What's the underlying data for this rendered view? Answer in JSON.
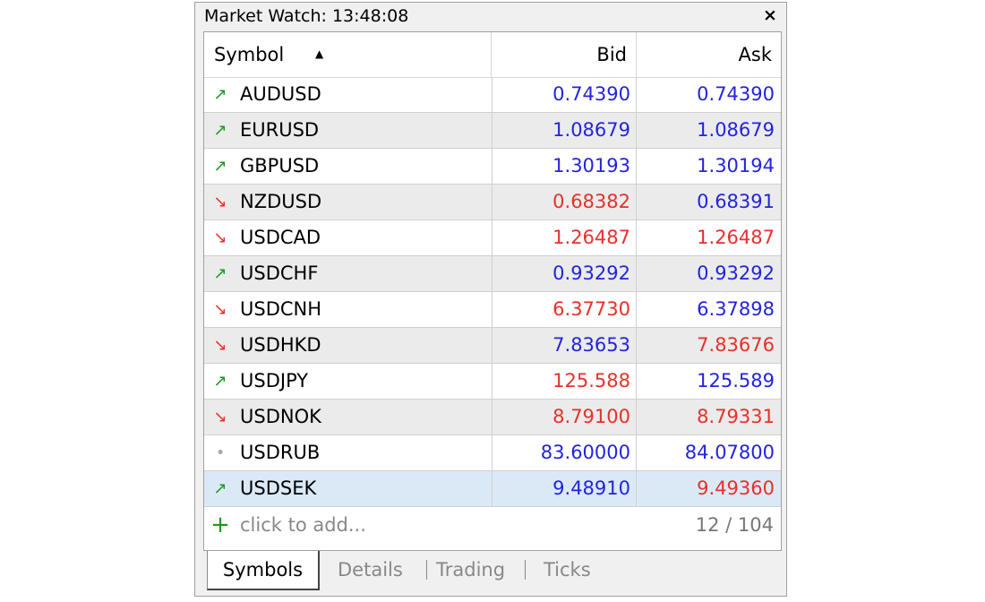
{
  "window": {
    "title": "Market Watch: 13:48:08",
    "close_glyph": "×"
  },
  "columns": {
    "symbol": "Symbol",
    "bid": "Bid",
    "ask": "Ask",
    "sort_glyph": "▲"
  },
  "colors": {
    "up": "#1a9a1a",
    "down": "#e8302a",
    "neutral": "#aaaaaa",
    "price_blue": "#2323e0",
    "price_red": "#e8302a"
  },
  "rows": [
    {
      "dir": "↗",
      "trend": "up",
      "symbol": "AUDUSD",
      "bid": "0.74390",
      "ask": "0.74390",
      "bid_color": "blue",
      "ask_color": "blue"
    },
    {
      "dir": "↗",
      "trend": "up",
      "symbol": "EURUSD",
      "bid": "1.08679",
      "ask": "1.08679",
      "bid_color": "blue",
      "ask_color": "blue"
    },
    {
      "dir": "↗",
      "trend": "up",
      "symbol": "GBPUSD",
      "bid": "1.30193",
      "ask": "1.30194",
      "bid_color": "blue",
      "ask_color": "blue"
    },
    {
      "dir": "↘",
      "trend": "down",
      "symbol": "NZDUSD",
      "bid": "0.68382",
      "ask": "0.68391",
      "bid_color": "red",
      "ask_color": "blue"
    },
    {
      "dir": "↘",
      "trend": "down",
      "symbol": "USDCAD",
      "bid": "1.26487",
      "ask": "1.26487",
      "bid_color": "red",
      "ask_color": "red"
    },
    {
      "dir": "↗",
      "trend": "up",
      "symbol": "USDCHF",
      "bid": "0.93292",
      "ask": "0.93292",
      "bid_color": "blue",
      "ask_color": "blue"
    },
    {
      "dir": "↘",
      "trend": "down",
      "symbol": "USDCNH",
      "bid": "6.37730",
      "ask": "6.37898",
      "bid_color": "red",
      "ask_color": "blue"
    },
    {
      "dir": "↘",
      "trend": "down",
      "symbol": "USDHKD",
      "bid": "7.83653",
      "ask": "7.83676",
      "bid_color": "blue",
      "ask_color": "red"
    },
    {
      "dir": "↗",
      "trend": "up",
      "symbol": "USDJPY",
      "bid": "125.588",
      "ask": "125.589",
      "bid_color": "red",
      "ask_color": "blue"
    },
    {
      "dir": "↘",
      "trend": "down",
      "symbol": "USDNOK",
      "bid": "8.79100",
      "ask": "8.79331",
      "bid_color": "red",
      "ask_color": "red"
    },
    {
      "dir": "•",
      "trend": "neutral",
      "symbol": "USDRUB",
      "bid": "83.60000",
      "ask": "84.07800",
      "bid_color": "blue",
      "ask_color": "blue"
    },
    {
      "dir": "↗",
      "trend": "up",
      "symbol": "USDSEK",
      "bid": "9.48910",
      "ask": "9.49360",
      "bid_color": "blue",
      "ask_color": "red",
      "selected": true
    }
  ],
  "footer": {
    "plus_glyph": "+",
    "add_label": "click to add...",
    "count": "12 / 104"
  },
  "tabs": [
    {
      "label": "Symbols",
      "active": true
    },
    {
      "label": "Details",
      "active": false
    },
    {
      "label": "Trading",
      "active": false
    },
    {
      "label": "Ticks",
      "active": false
    }
  ]
}
